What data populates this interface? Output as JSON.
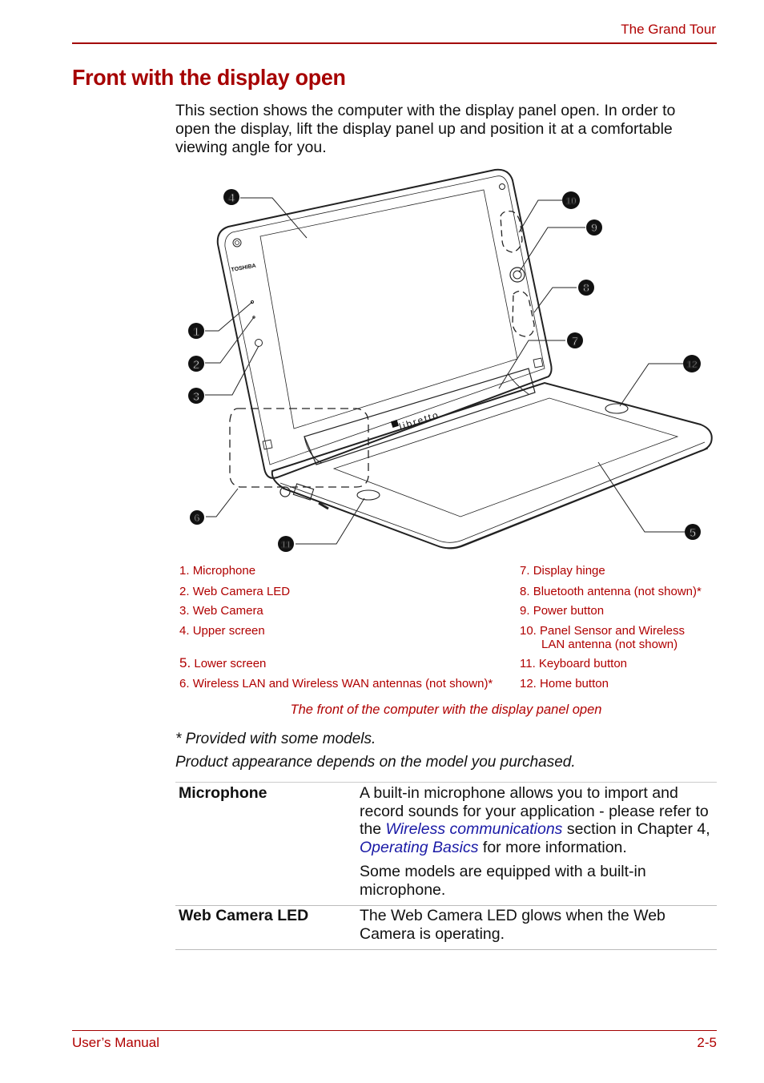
{
  "header": {
    "running_title": "The Grand Tour"
  },
  "section": {
    "title": "Front with the display open",
    "intro": "This section shows the computer with the display panel open. In order to open the display, lift the display panel up and position it at a comfortable viewing angle for you."
  },
  "figure": {
    "brand_text": "TOSHIBA",
    "product_text": "libretto",
    "callouts": [
      "1",
      "2",
      "3",
      "4",
      "5",
      "6",
      "7",
      "8",
      "9",
      "10",
      "11",
      "12"
    ],
    "legend_left": [
      {
        "num": "1.",
        "label": "Microphone"
      },
      {
        "num": "2.",
        "label": "Web Camera LED"
      },
      {
        "num": "3.",
        "label": "Web Camera"
      },
      {
        "num": "4.",
        "label": "Upper screen"
      },
      {
        "num": "5.",
        "label": "Lower screen"
      },
      {
        "num": "6.",
        "label": "Wireless LAN and Wireless WAN antennas (not shown)*"
      }
    ],
    "legend_right": [
      {
        "num": "7.",
        "label": "Display hinge"
      },
      {
        "num": "8.",
        "label": "Bluetooth antenna (not shown)*"
      },
      {
        "num": "9.",
        "label": "Power button"
      },
      {
        "num": "10.",
        "label": "Panel Sensor and Wireless",
        "label_cont": "LAN antenna (not shown)"
      },
      {
        "num": "11.",
        "label": "Keyboard button"
      },
      {
        "num": "12.",
        "label": "Home button"
      }
    ],
    "caption": "The front of the computer with the display panel open"
  },
  "notes": {
    "provided": "* Provided with some models.",
    "appearance": "Product appearance depends on the model you purchased."
  },
  "spec_table": {
    "rows": [
      {
        "term": "Microphone",
        "desc_p1_a": "A built-in microphone allows you to import and record sounds for your application - please refer to the ",
        "desc_p1_link1": "Wireless communications",
        "desc_p1_b": " section in Chapter 4, ",
        "desc_p1_link2": "Operating Basics",
        "desc_p1_c": " for more information.",
        "desc_p2": "Some models are equipped with a built-in microphone."
      },
      {
        "term": "Web Camera LED",
        "desc_p1": "The Web Camera LED glows when the Web Camera is operating."
      }
    ]
  },
  "footer": {
    "left": "User’s Manual",
    "right": "2-5"
  },
  "colors": {
    "accent": "#a60000",
    "link": "#1a1aa6",
    "rule": "#a30000"
  }
}
